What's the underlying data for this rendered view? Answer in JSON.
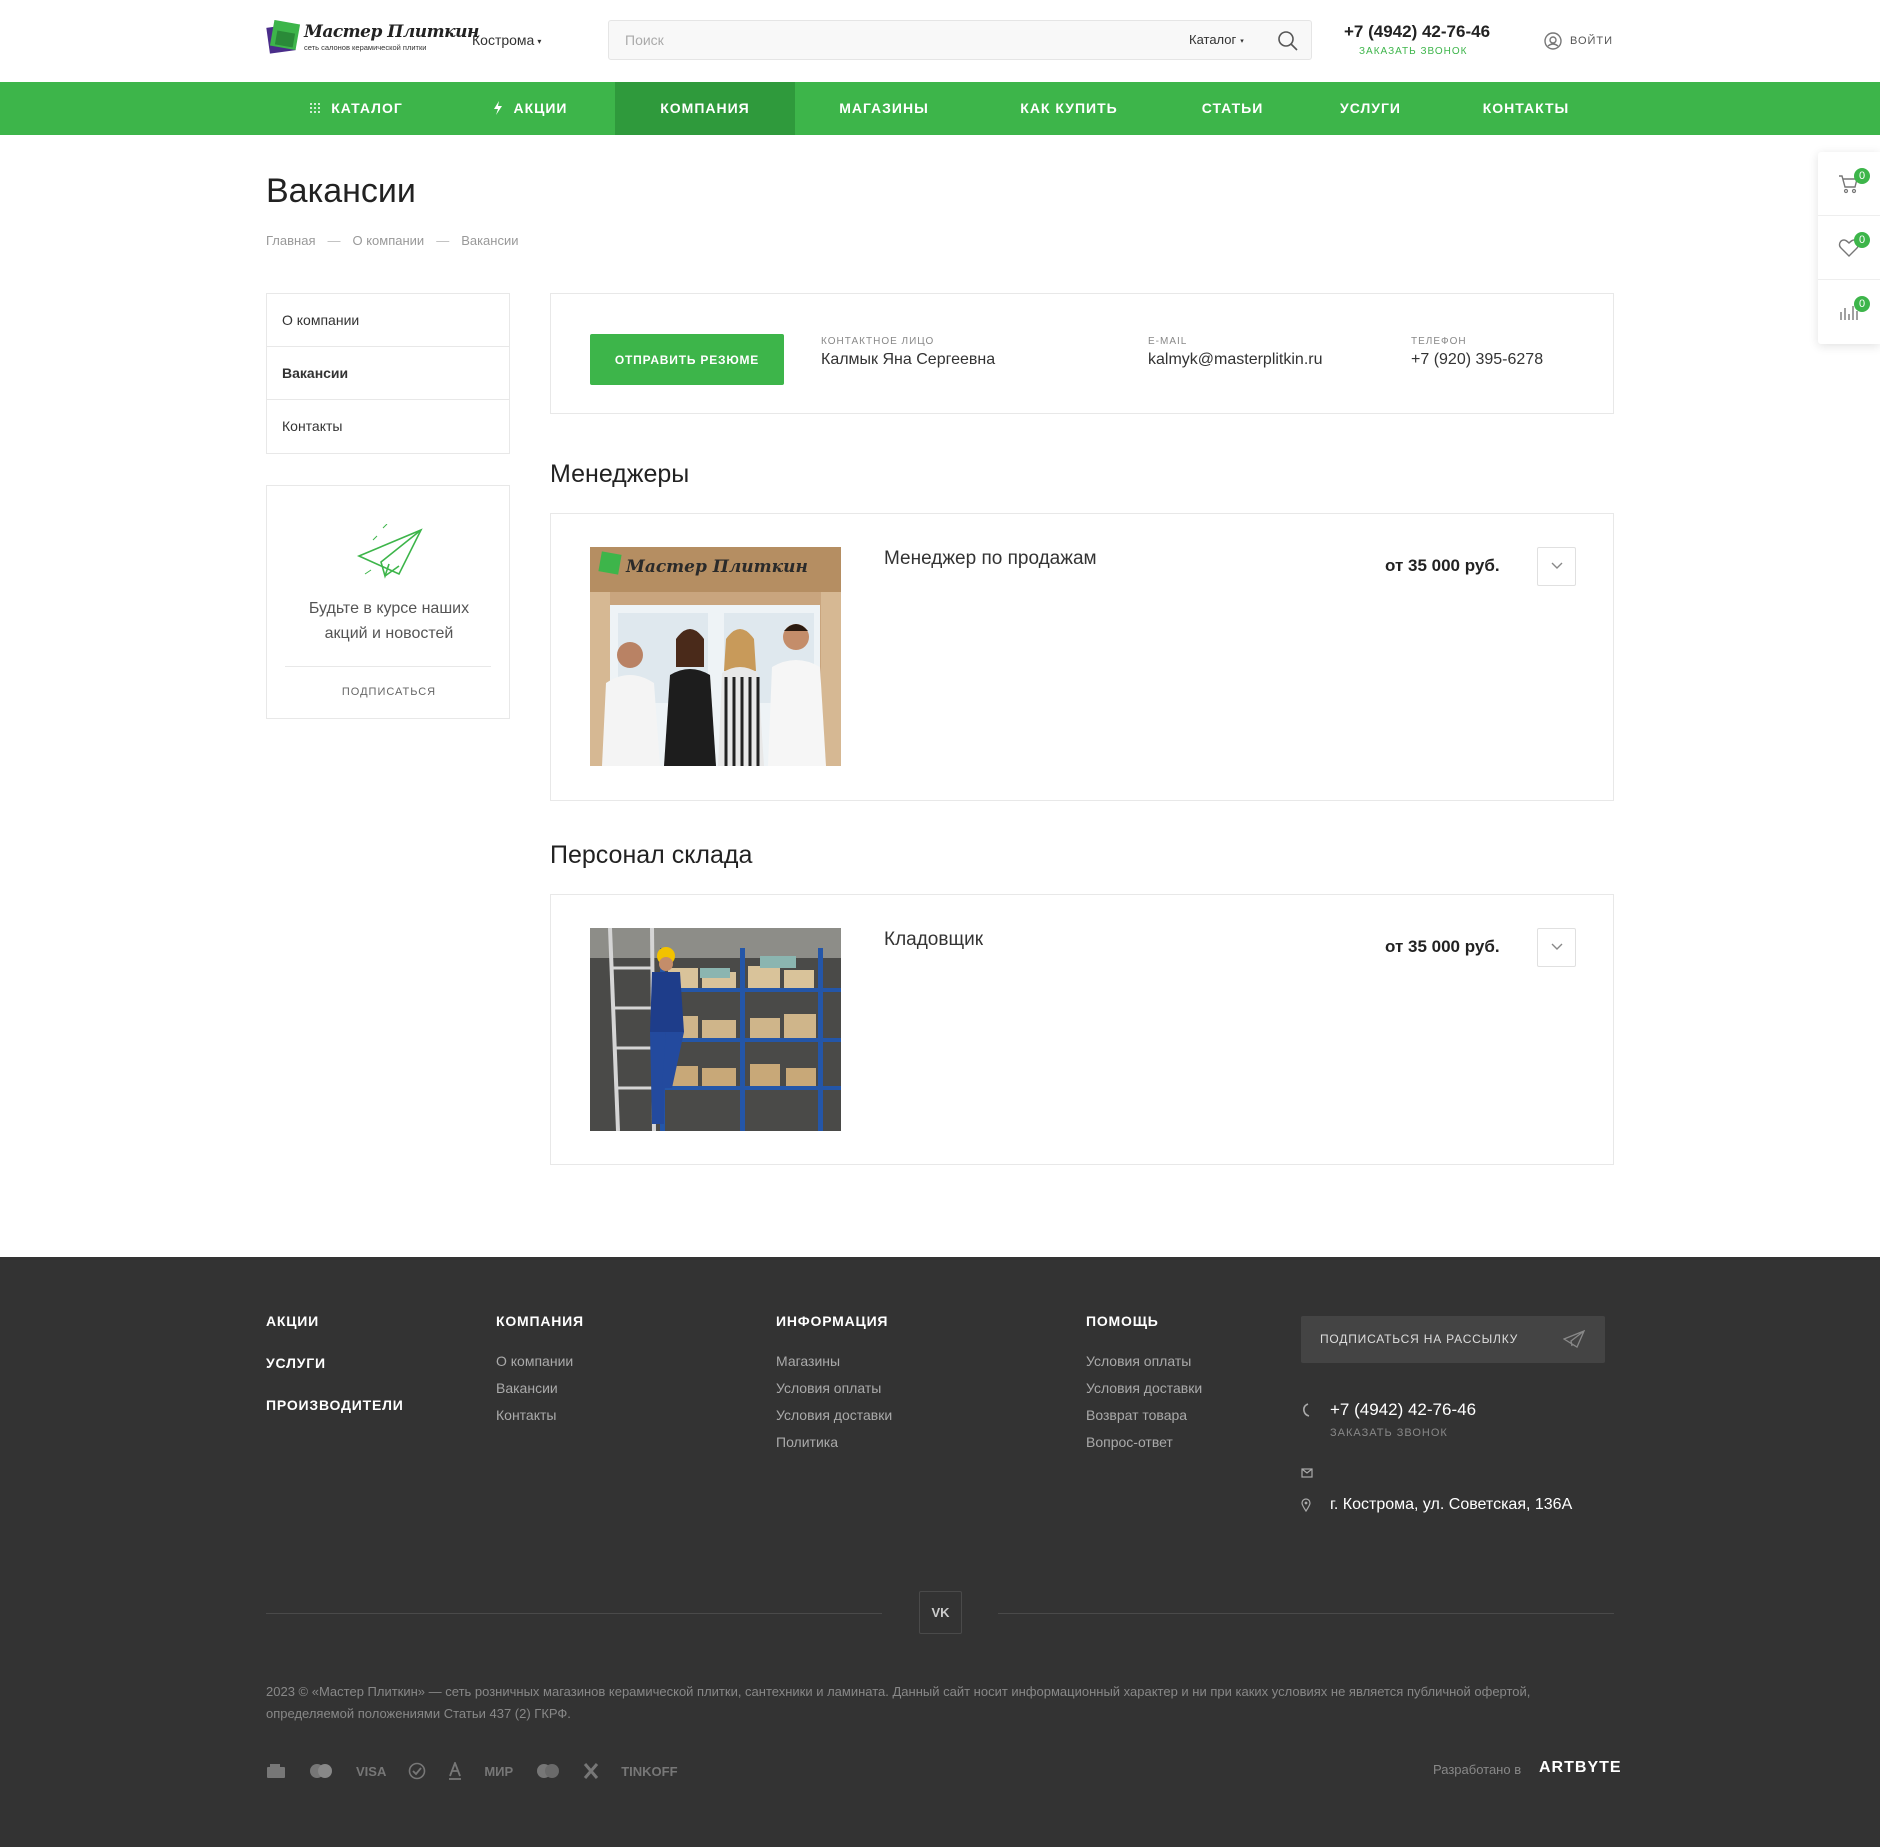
{
  "header": {
    "logo": {
      "title": "Мастер Плиткин",
      "subtitle": "сеть салонов керамической плитки"
    },
    "city": "Кострома",
    "search": {
      "placeholder": "Поиск",
      "category": "Каталог"
    },
    "phone": "+7 (4942) 42-76-46",
    "callback": "ЗАКАЗАТЬ ЗВОНОК",
    "login": "ВОЙТИ"
  },
  "nav": {
    "items": [
      {
        "label": "КАТАЛОГ"
      },
      {
        "label": "АКЦИИ"
      },
      {
        "label": "КОМПАНИЯ"
      },
      {
        "label": "МАГАЗИНЫ"
      },
      {
        "label": "КАК КУПИТЬ"
      },
      {
        "label": "СТАТЬИ"
      },
      {
        "label": "УСЛУГИ"
      },
      {
        "label": "КОНТАКТЫ"
      }
    ],
    "active": "КОМПАНИЯ"
  },
  "side_panel": {
    "cart_count": "0",
    "favorites_count": "0",
    "compare_count": "0"
  },
  "page": {
    "title": "Вакансии",
    "breadcrumb": [
      "Главная",
      "О компании",
      "Вакансии"
    ]
  },
  "left_menu": {
    "items": [
      "О компании",
      "Вакансии",
      "Контакты"
    ],
    "active": "Вакансии"
  },
  "subscribe_box": {
    "text": "Будьте в курсе наших акций и новостей",
    "link": "ПОДПИСАТЬСЯ"
  },
  "contact_bar": {
    "button": "ОТПРАВИТЬ РЕЗЮМЕ",
    "contact_label": "КОНТАКТНОЕ ЛИЦО",
    "contact_value": "Калмык Яна Сергеевна",
    "email_label": "E-MAIL",
    "email_value": "kalmyk@masterplitkin.ru",
    "phone_label": "ТЕЛЕФОН",
    "phone_value": "+7 (920) 395-6278"
  },
  "sections": [
    {
      "title": "Менеджеры",
      "vacancies": [
        {
          "title": "Менеджер по продажам",
          "salary": "от 35 000 руб.",
          "image_sign": "Мастер Плиткин"
        }
      ]
    },
    {
      "title": "Персонал склада",
      "vacancies": [
        {
          "title": "Кладовщик",
          "salary": "от 35 000 руб."
        }
      ]
    }
  ],
  "footer": {
    "col1": [
      "АКЦИИ",
      "УСЛУГИ",
      "ПРОИЗВОДИТЕЛИ"
    ],
    "col2": {
      "head": "КОМПАНИЯ",
      "links": [
        "О компании",
        "Вакансии",
        "Контакты"
      ]
    },
    "col3": {
      "head": "ИНФОРМАЦИЯ",
      "links": [
        "Магазины",
        "Условия оплаты",
        "Условия доставки",
        "Политика"
      ]
    },
    "col4": {
      "head": "ПОМОЩЬ",
      "links": [
        "Условия оплаты",
        "Условия доставки",
        "Возврат товара",
        "Вопрос-ответ"
      ]
    },
    "subscribe": "ПОДПИСАТЬСЯ НА РАССЫЛКУ",
    "phone": "+7 (4942) 42-76-46",
    "callback": "ЗАКАЗАТЬ ЗВОНОК",
    "address": "г. Кострома, ул. Советская, 136А",
    "social": "VK",
    "copyright": "2023 © «Мастер Плиткин» — сеть розничных магазинов керамической плитки, сантехники и ламината. Данный сайт носит информационный характер и ни при каких условиях не является публичной офертой, определяемой положениями Статьи 437 (2) ГКРФ.",
    "payments": [
      "VISA",
      "МИР",
      "TINKOFF"
    ],
    "developed_by": "Разработано в",
    "developer": "ARTBYTE"
  },
  "colors": {
    "brand_green": "#3db54a",
    "nav_active": "#2f9a3c",
    "footer_bg": "#333333"
  }
}
